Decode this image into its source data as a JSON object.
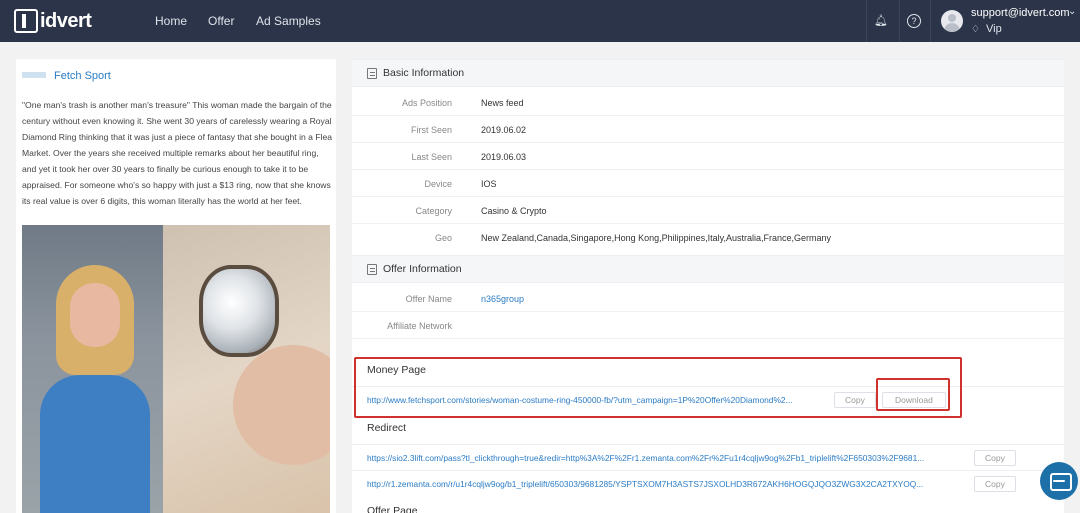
{
  "topbar": {
    "logo_text": "idvert",
    "nav": [
      "Home",
      "Offer",
      "Ad Samples"
    ],
    "user_email": "support@idvert.com",
    "user_tier": "Vip",
    "icons": [
      "bell-icon",
      "help-icon",
      "diamond-icon",
      "chevron-down-icon"
    ]
  },
  "ad": {
    "brand_name": "Fetch Sport",
    "text": "\"One man's trash is another man's treasure\" This woman made the bargain of the century without even knowing it. She went 30 years of carelessly wearing a Royal Diamond Ring thinking that it was just a piece of fantasy that she bought in a Flea Market. Over the years she received multiple remarks about her beautiful ring, and yet it took her over 30 years to finally be curious enough to take it to be appraised. For someone who's so happy with just a $13 ring, now that she knows its real value is over 6 digits, this woman literally has the world at her feet."
  },
  "basic": {
    "title": "Basic Information",
    "rows": [
      {
        "label": "Ads Position",
        "value": "News feed"
      },
      {
        "label": "First Seen",
        "value": "2019.06.02"
      },
      {
        "label": "Last Seen",
        "value": "2019.06.03"
      },
      {
        "label": "Device",
        "value": "IOS"
      },
      {
        "label": "Category",
        "value": "Casino & Crypto"
      },
      {
        "label": "Geo",
        "value": "New Zealand,Canada,Singapore,Hong Kong,Philippines,Italy,Australia,France,Germany"
      }
    ]
  },
  "offer": {
    "title": "Offer Information",
    "rows": [
      {
        "label": "Offer Name",
        "value": "n365group"
      },
      {
        "label": "Affiliate Network",
        "value": ""
      }
    ]
  },
  "money_page": {
    "title": "Money Page",
    "url": "http://www.fetchsport.com/stories/woman-costume-ring-450000-fb/?utm_campaign=1P%20Offer%20Diamond%2...",
    "copy_label": "Copy",
    "download_label": "Download"
  },
  "redirect": {
    "title": "Redirect",
    "urls": [
      "https://sio2.3lift.com/pass?tl_clickthrough=true&redir=http%3A%2F%2Fr1.zemanta.com%2Fr%2Fu1r4cqljw9og%2Fb1_triplelift%2F650303%2F9681...",
      "http://r1.zemanta.com/r/u1r4cqljw9og/b1_triplelift/650303/9681285/YSPTSXOM7H3ASTS7JSXOLHD3R672AKH6HOGQJQO3ZWG3X2CA2TXYOQ..."
    ],
    "copy_label": "Copy"
  },
  "offer_page": {
    "title": "Offer Page"
  }
}
